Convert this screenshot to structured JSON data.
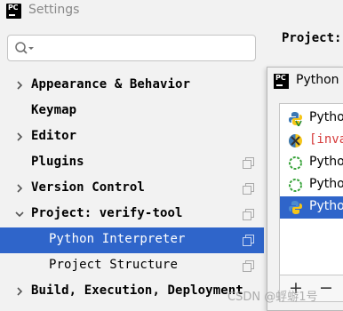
{
  "window": {
    "app_icon_text": "PC",
    "title": "Settings"
  },
  "search": {
    "placeholder": "",
    "value": ""
  },
  "tree": [
    {
      "label": "Appearance & Behavior",
      "expander": "collapsed",
      "copy_icon": false,
      "selected": false,
      "level": 0
    },
    {
      "label": "Keymap",
      "expander": "none",
      "copy_icon": false,
      "selected": false,
      "level": 0
    },
    {
      "label": "Editor",
      "expander": "collapsed",
      "copy_icon": false,
      "selected": false,
      "level": 0
    },
    {
      "label": "Plugins",
      "expander": "none",
      "copy_icon": true,
      "selected": false,
      "level": 0
    },
    {
      "label": "Version Control",
      "expander": "collapsed",
      "copy_icon": true,
      "selected": false,
      "level": 0
    },
    {
      "label": "Project: verify-tool",
      "expander": "expanded",
      "copy_icon": true,
      "selected": false,
      "level": 0
    },
    {
      "label": "Python Interpreter",
      "expander": "none",
      "copy_icon": true,
      "selected": true,
      "level": 1
    },
    {
      "label": "Project Structure",
      "expander": "none",
      "copy_icon": true,
      "selected": false,
      "level": 1
    },
    {
      "label": "Build, Execution, Deployment",
      "expander": "collapsed",
      "copy_icon": false,
      "selected": false,
      "level": 0
    }
  ],
  "right_panel": {
    "project_label": "Project:"
  },
  "dialog": {
    "app_icon_text": "PC",
    "title": "Python",
    "interpreters": [
      {
        "label": "Pytho",
        "icon": "python-venv-icon",
        "state": "normal",
        "selected": false
      },
      {
        "label": "[inva",
        "icon": "invalid-python-icon",
        "state": "invalid",
        "selected": false
      },
      {
        "label": "Pytho",
        "icon": "loading-spinner-icon",
        "state": "normal",
        "selected": false
      },
      {
        "label": "Pytho",
        "icon": "loading-spinner-icon",
        "state": "normal",
        "selected": false
      },
      {
        "label": "Pytho",
        "icon": "python-icon",
        "state": "normal",
        "selected": true
      }
    ],
    "toolbar": {
      "add_label": "+",
      "remove_label": "−"
    }
  },
  "watermark": "CSDN @蜉蝣1号",
  "colors": {
    "selection": "#2f65ca",
    "background": "#f2f2f2",
    "invalid_text": "#d63a3a"
  }
}
